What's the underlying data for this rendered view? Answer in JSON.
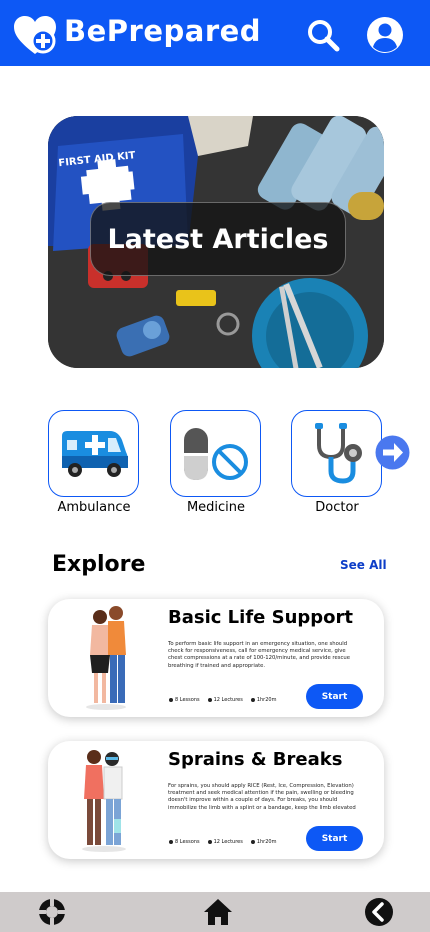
{
  "header": {
    "brand": "BePrepared",
    "logo_icon": "heart-plus-icon",
    "search_icon": "search-icon",
    "profile_icon": "user-circle-icon",
    "color": "#0d58f5"
  },
  "hero": {
    "title": "Latest Articles"
  },
  "categories": {
    "items": [
      {
        "label": "Ambulance",
        "icon": "ambulance-icon"
      },
      {
        "label": "Medicine",
        "icon": "medicine-icon"
      },
      {
        "label": "Doctor",
        "icon": "stethoscope-icon"
      }
    ],
    "next_icon": "arrow-right-circle-icon"
  },
  "explore": {
    "title": "Explore",
    "see_all": "See All",
    "cards": [
      {
        "title": "Basic Life Support",
        "description": "To perform basic life support in an emergency situation, one should check for responsiveness, call for emergency medical service, give chest compressions at a rate of 100-120/minute, and provide rescue breathing if trained and appropriate.",
        "lessons": "8 Lessons",
        "lectures": "12 Lectures",
        "duration": "1hr20m",
        "button": "Start"
      },
      {
        "title": "Sprains & Breaks",
        "description": "For sprains, you should apply RICE (Rest, Ice, Compression, Elevation) treatment and seek medical attention if the pain, swelling or bleeding doesn't improve within a couple of days. For breaks, you should immobilize the limb with a splint or a bandage, keep the limb elevated",
        "lessons": "8 Lessons",
        "lectures": "12 Lectures",
        "duration": "1hr20m",
        "button": "Start"
      }
    ]
  },
  "bottom_nav": {
    "left_icon": "lifebuoy-icon",
    "center_icon": "home-icon",
    "right_icon": "back-chevron-icon",
    "background": "#cfcbcb"
  }
}
